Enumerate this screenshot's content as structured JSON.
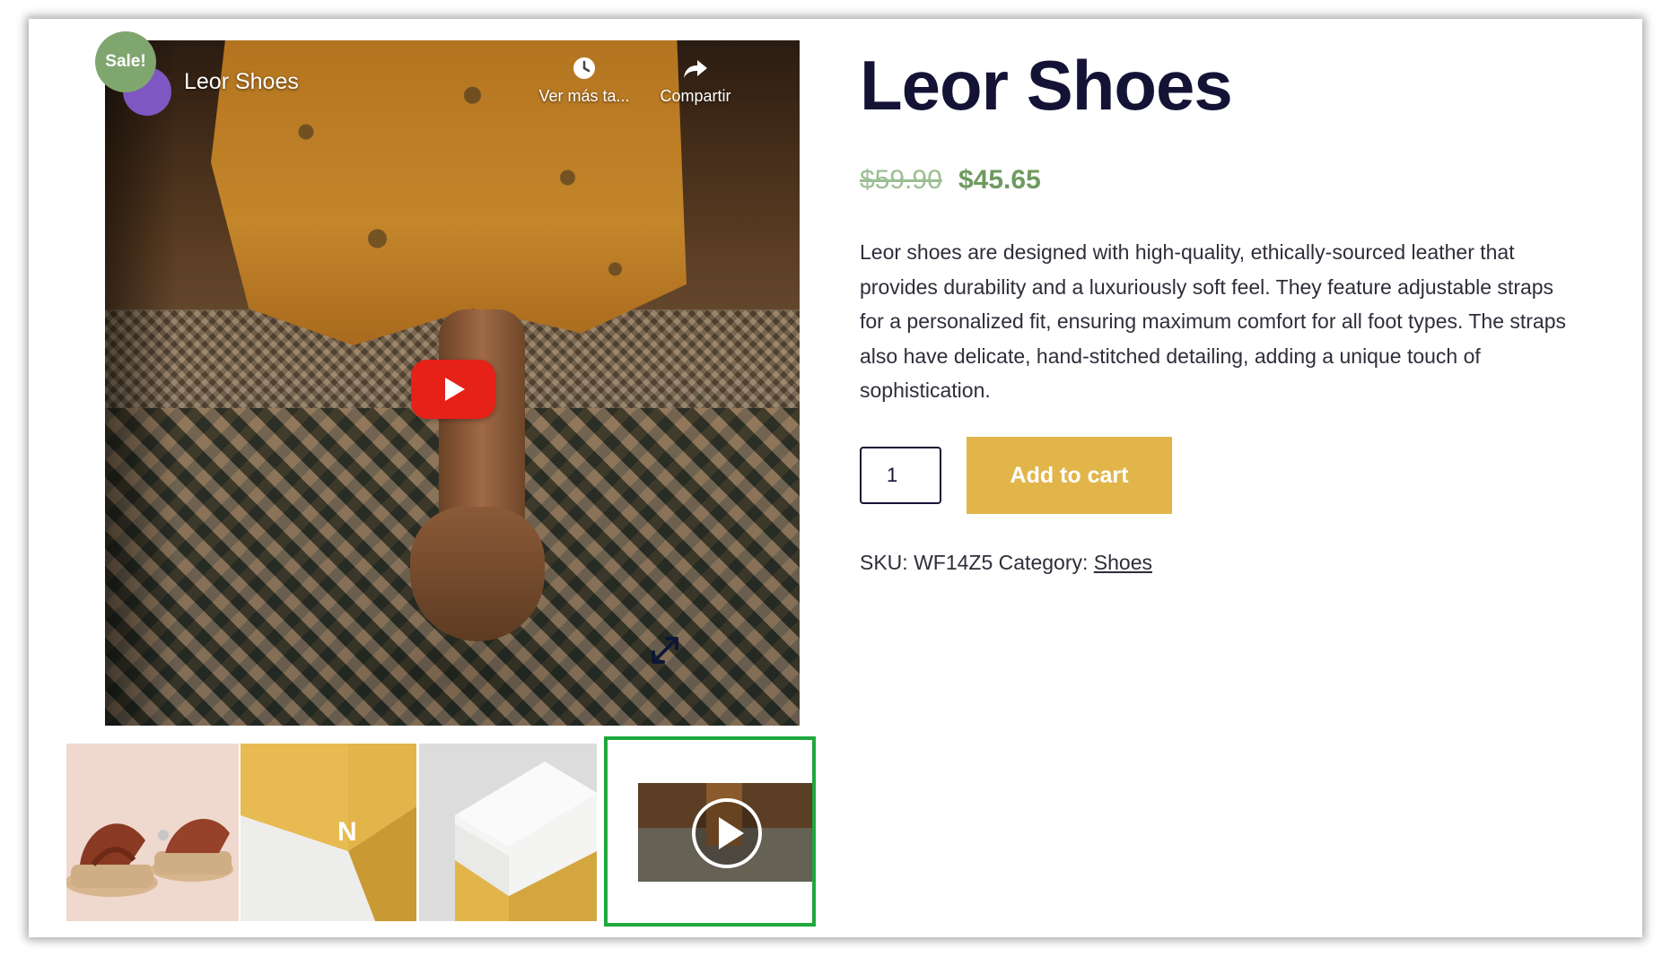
{
  "video": {
    "channel_title": "Leor Shoes",
    "watch_later_label": "Ver más ta...",
    "share_label": "Compartir"
  },
  "sale_badge": "Sale!",
  "product": {
    "title": "Leor Shoes",
    "price_old": "$59.90",
    "price_new": "$45.65",
    "description": "Leor shoes are designed with high-quality, ethically-sourced leather that provides durability and a luxuriously soft feel. They feature adjustable straps for a personalized fit, ensuring maximum comfort for all foot types. The straps also have delicate, hand-stitched detailing, adding a unique touch of sophistication.",
    "quantity": "1",
    "add_to_cart_label": "Add to cart",
    "sku_label": "SKU:",
    "sku_value": "WF14Z5",
    "category_label": "Category:",
    "category_value": "Shoes"
  },
  "thumbnails": [
    {
      "name": "sandals"
    },
    {
      "name": "yellow-box-n"
    },
    {
      "name": "white-box-new-apparel"
    },
    {
      "name": "video",
      "selected": true
    }
  ],
  "colors": {
    "title": "#141336",
    "sale_badge": "#7fa66f",
    "price_new": "#6f9a5f",
    "price_old": "#9bbf92",
    "accent_button": "#e2b54b",
    "selected_thumb_border": "#1fa83b",
    "youtube_red": "#e62117"
  }
}
